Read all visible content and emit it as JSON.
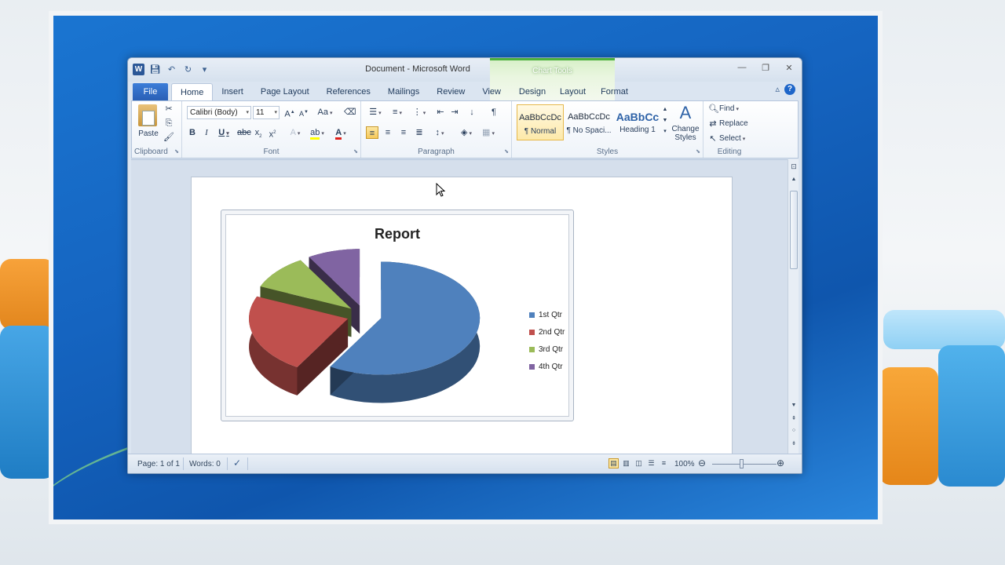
{
  "window": {
    "title": "Document - Microsoft Word",
    "context_tab_group": "Chart Tools"
  },
  "tabs": [
    {
      "label": "File"
    },
    {
      "label": "Home"
    },
    {
      "label": "Insert"
    },
    {
      "label": "Page Layout"
    },
    {
      "label": "References"
    },
    {
      "label": "Mailings"
    },
    {
      "label": "Review"
    },
    {
      "label": "View"
    },
    {
      "label": "Design"
    },
    {
      "label": "Layout"
    },
    {
      "label": "Format"
    }
  ],
  "ribbon": {
    "clipboard": {
      "paste": "Paste",
      "label": "Clipboard"
    },
    "font": {
      "name": "Calibri (Body)",
      "size": "11",
      "label": "Font"
    },
    "paragraph": {
      "label": "Paragraph"
    },
    "styles": {
      "label": "Styles",
      "items": [
        {
          "sample": "AaBbCcDc",
          "name": "¶ Normal"
        },
        {
          "sample": "AaBbCcDc",
          "name": "¶ No Spaci..."
        },
        {
          "sample": "AaBbCc",
          "name": "Heading 1"
        }
      ],
      "change_styles": "Change Styles"
    },
    "editing": {
      "label": "Editing",
      "find": "Find",
      "replace": "Replace",
      "select": "Select"
    }
  },
  "chart_data": {
    "type": "pie",
    "title": "Report",
    "categories": [
      "1st Qtr",
      "2nd Qtr",
      "3rd Qtr",
      "4th Qtr"
    ],
    "values": [
      8.2,
      3.2,
      1.4,
      1.2
    ],
    "colors": [
      "#4f81bd",
      "#c0504d",
      "#9bbb59",
      "#8064a2"
    ],
    "style": "exploded 3-D pie",
    "legend_position": "right"
  },
  "statusbar": {
    "page": "Page: 1 of 1",
    "words": "Words: 0",
    "zoom": "100%"
  }
}
